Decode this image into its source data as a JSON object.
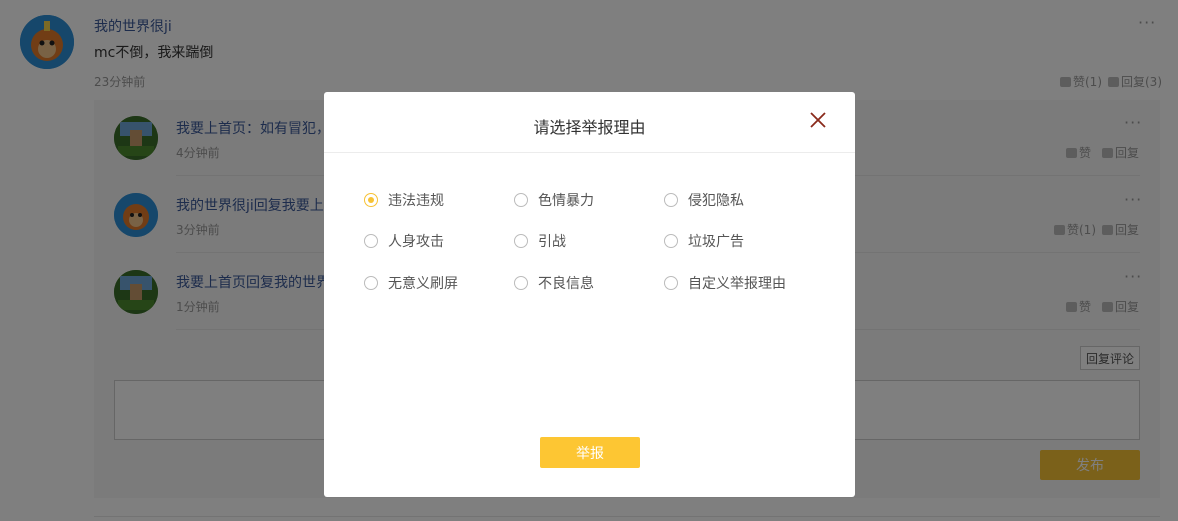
{
  "thread": {
    "main": {
      "author": "我的世界很ji",
      "text": "mc不倒，我来踹倒",
      "time": "23分钟前",
      "like_label": "赞(1)",
      "reply_label": "回复(3)",
      "more": "···"
    },
    "replies": [
      {
        "author": "我要上首页：如有冒犯，",
        "time": "4分钟前",
        "like_label": "赞",
        "reply_label": "回复",
        "more": "···",
        "avatar": "pixel"
      },
      {
        "author": "我的世界很ji回复我要上",
        "time": "3分钟前",
        "like_label": "赞(1)",
        "reply_label": "回复",
        "more": "···",
        "avatar": "monkey"
      },
      {
        "author": "我要上首页回复我的世界",
        "time": "1分钟前",
        "like_label": "赞",
        "reply_label": "回复",
        "more": "···",
        "avatar": "pixel"
      }
    ],
    "reply_comment_label": "回复评论",
    "publish_label": "发布"
  },
  "modal": {
    "title": "请选择举报理由",
    "options": [
      "违法违规",
      "色情暴力",
      "侵犯隐私",
      "人身攻击",
      "引战",
      "垃圾广告",
      "无意义刷屏",
      "不良信息",
      "自定义举报理由"
    ],
    "selected_option": "违法违规",
    "submit_label": "举报"
  },
  "colors": {
    "accent": "#fdc633",
    "author_link": "#3b5998",
    "close_icon": "#8a2a1b"
  }
}
